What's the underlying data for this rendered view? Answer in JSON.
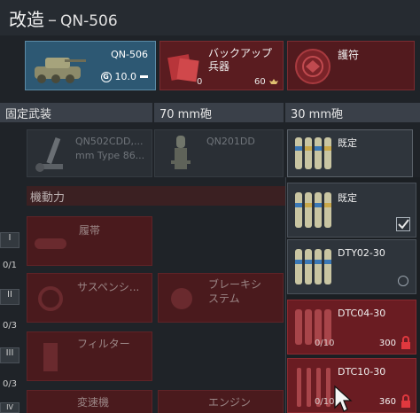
{
  "header": {
    "title": "改造",
    "separator": "–",
    "model": "QN-506"
  },
  "top_cards": {
    "vehicle": {
      "name": "QN-506",
      "battle_rating": "10.0"
    },
    "backup": {
      "label": "バックアップ兵器",
      "count": "0",
      "cost": "60"
    },
    "talisman": {
      "label": "護符"
    }
  },
  "categories": {
    "fixed": "固定武装",
    "gun70": "70 mm砲",
    "gun30": "30 mm砲"
  },
  "fixed_weapons": {
    "item1_line1": "QN502CDD,...",
    "item1_line2": "mm Type 86...",
    "item2": "QN201DD"
  },
  "gun30_slot": {
    "label": "既定"
  },
  "mobility": {
    "head": "機動力",
    "tiers": [
      "I",
      "II",
      "III",
      "IV"
    ],
    "counts": [
      "0/1",
      "0/3",
      "0/3"
    ],
    "items": {
      "track": "履帯",
      "suspension": "サスペンシ...",
      "brake": "ブレーキシステム",
      "filter": "フィルター",
      "transmission": "変速機",
      "engine": "エンジン"
    }
  },
  "ammo_options": [
    {
      "name": "既定",
      "state": "selected"
    },
    {
      "name": "DTY02-30",
      "state": "available"
    },
    {
      "name": "DTC04-30",
      "state": "locked",
      "count": "0/10",
      "cost": "300"
    },
    {
      "name": "DTC10-30",
      "state": "locked",
      "count": "0/10",
      "cost": "360"
    }
  ],
  "colors": {
    "accent_blue": "#2d5873",
    "locked_red": "#6a1c22",
    "header_bg": "#262b31"
  }
}
